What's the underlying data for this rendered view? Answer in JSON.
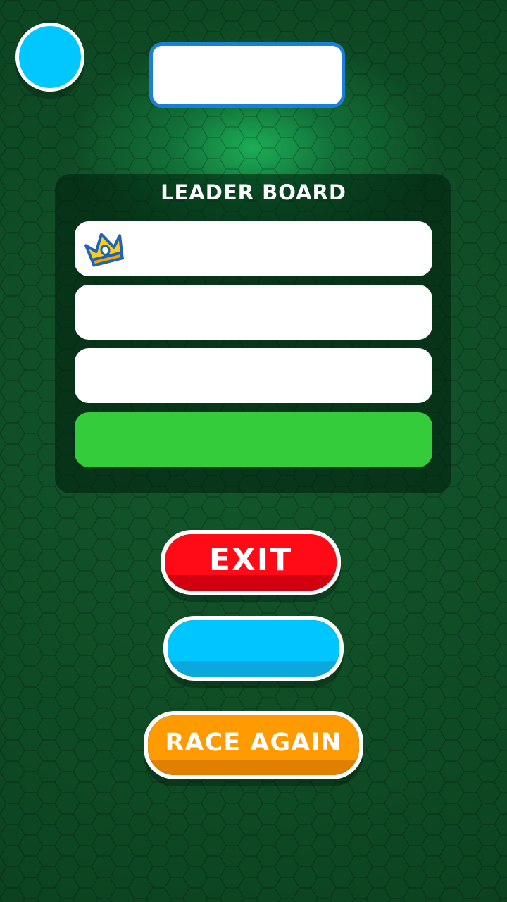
{
  "leaderboard": {
    "title": "LEADER BOARD",
    "rows": [
      {
        "icon": "crown-icon",
        "highlight": false
      },
      {
        "highlight": false
      },
      {
        "highlight": false
      },
      {
        "highlight": true
      }
    ]
  },
  "buttons": {
    "exit_label": "EXIT",
    "race_again_label": "RACE AGAIN"
  },
  "colors": {
    "background": "#0f4a24",
    "avatar": "#00c8ff",
    "name_plate_border": "#1a7fd6",
    "player_row": "#34cc3a",
    "exit_button": "#ff0a16",
    "blue_button": "#00c6ff",
    "race_again_button": "#ff9a00"
  }
}
